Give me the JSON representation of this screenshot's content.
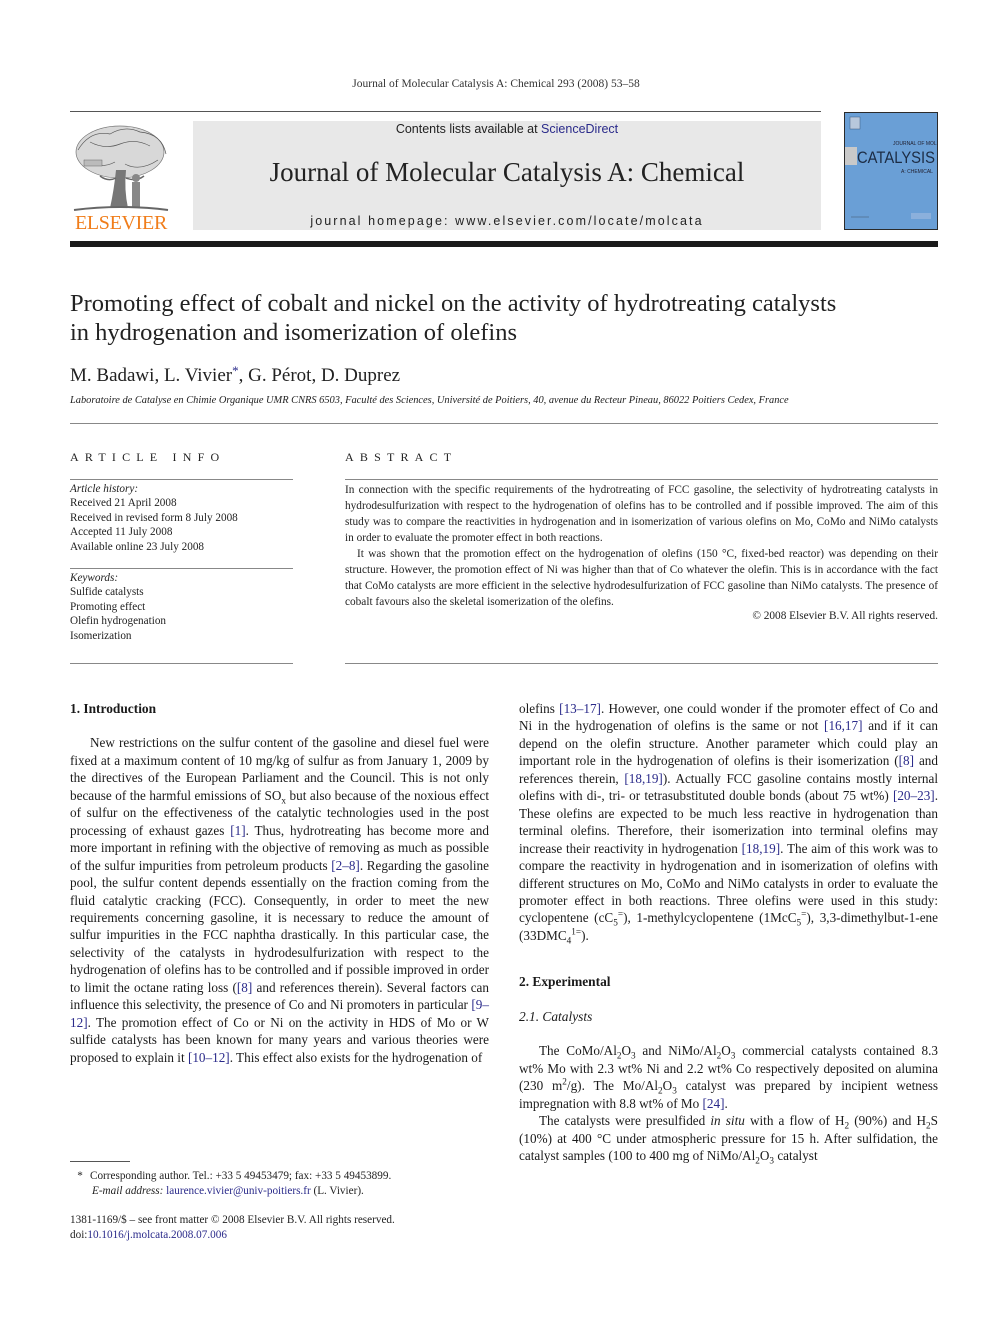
{
  "running_header": "Journal of Molecular Catalysis A: Chemical 293 (2008) 53–58",
  "masthead": {
    "publisher_logo": "ELSEVIER",
    "contents_prefix": "Contents lists available at ",
    "contents_link": "ScienceDirect",
    "journal_title": "Journal of Molecular Catalysis A: Chemical",
    "homepage_label": "journal homepage: ",
    "homepage_url": "www.elsevier.com/locate/molcata",
    "cover": {
      "top_text": "JOURNAL OF MOLECULAR",
      "main_text": "CATALYSIS",
      "sub_text": "A: CHEMICAL",
      "color": "#6a9fd6"
    },
    "logo_color": "#f07d1a"
  },
  "article": {
    "title_line1": "Promoting effect of cobalt and nickel on the activity of hydrotreating catalysts",
    "title_line2": "in hydrogenation and isomerization of olefins",
    "authors": [
      {
        "name": "M. Badawi",
        "sep": ", "
      },
      {
        "name": "L. Vivier",
        "mark": "*",
        "sep": ", "
      },
      {
        "name": "G. Pérot",
        "sep": ", "
      },
      {
        "name": "D. Duprez",
        "sep": ""
      }
    ],
    "affiliation": "Laboratoire de Catalyse en Chimie Organique UMR CNRS 6503, Faculté des Sciences, Université de Poitiers, 40, avenue du Recteur Pineau, 86022 Poitiers Cedex, France"
  },
  "article_info": {
    "heading": "ARTICLE INFO",
    "history_label": "Article history:",
    "history": [
      "Received 21 April 2008",
      "Received in revised form 8 July 2008",
      "Accepted 11 July 2008",
      "Available online 23 July 2008"
    ],
    "keywords_label": "Keywords:",
    "keywords": [
      "Sulfide catalysts",
      "Promoting effect",
      "Olefin hydrogenation",
      "Isomerization"
    ]
  },
  "abstract": {
    "heading": "ABSTRACT",
    "paragraphs": [
      "In connection with the specific requirements of the hydrotreating of FCC gasoline, the selectivity of hydrotreating catalysts in hydrodesulfurization with respect to the hydrogenation of olefins has to be controlled and if possible improved. The aim of this study was to compare the reactivities in hydrogenation and in isomerization of various olefins on Mo, CoMo and NiMo catalysts in order to evaluate the promoter effect in both reactions.",
      "It was shown that the promotion effect on the hydrogenation of olefins (150 °C, fixed-bed reactor) was depending on their structure. However, the promotion effect of Ni was higher than that of Co whatever the olefin. This is in accordance with the fact that CoMo catalysts are more efficient in the selective hydrodesulfurization of FCC gasoline than NiMo catalysts. The presence of cobalt favours also the skeletal isomerization of the olefins."
    ],
    "copyright": "© 2008 Elsevier B.V. All rights reserved."
  },
  "body": {
    "intro_heading": "1.  Introduction",
    "intro_p1": [
      {
        "t": "New restrictions on the sulfur content of the gasoline and diesel fuel were fixed at a maximum content of 10 mg/kg of sulfur as from January 1, 2009 by the directives of the European Parliament and the Council. This is not only because of the harmful emissions of SO"
      },
      {
        "sub": "x"
      },
      {
        "t": " but also because of the noxious effect of sulfur on the effectiveness of the catalytic technologies used in the post processing of exhaust gazes "
      },
      {
        "ref": "[1]"
      },
      {
        "t": ". Thus, hydrotreating has become more and more important in refining with the objective of removing as much as possible of the sulfur impurities from petroleum products "
      },
      {
        "ref": "[2–8]"
      },
      {
        "t": ". Regarding the gasoline pool, the sulfur content depends essentially on the fraction coming from the fluid catalytic cracking (FCC). Consequently, in order to meet the new requirements concerning gasoline, it is necessary to reduce the amount of sulfur impurities in the FCC naphtha drastically. In this particular case, the selectivity of the catalysts in hydrodesulfurization with respect to the hydrogenation of olefins has to be controlled and if possible improved in order to limit the octane rating loss ("
      },
      {
        "ref": "[8]"
      },
      {
        "t": " and references therein). Several factors can influence this selectivity, the presence of Co and Ni promoters in particular "
      },
      {
        "ref": "[9–12]"
      },
      {
        "t": ". The promotion effect of Co or Ni on the activity in HDS of Mo or W sulfide catalysts has been known for many years and various theories were proposed to explain it "
      },
      {
        "ref": "[10–12]"
      },
      {
        "t": ". This effect also exists for the hydrogenation of"
      }
    ],
    "intro_p1_cont": [
      {
        "t": "olefins "
      },
      {
        "ref": "[13–17]"
      },
      {
        "t": ". However, one could wonder if the promoter effect of Co and Ni in the hydrogenation of olefins is the same or not "
      },
      {
        "ref": "[16,17]"
      },
      {
        "t": " and if it can depend on the olefin structure. Another parameter which could play an important role in the hydrogenation of olefins is their isomerization ("
      },
      {
        "ref": "[8]"
      },
      {
        "t": " and references therein, "
      },
      {
        "ref": "[18,19]"
      },
      {
        "t": "). Actually FCC gasoline contains mostly internal olefins with di-, tri- or tetrasubstituted double bonds (about 75 wt%) "
      },
      {
        "ref": "[20–23]"
      },
      {
        "t": ". These olefins are expected to be much less reactive in hydrogenation than terminal olefins. Therefore, their isomerization into terminal olefins may increase their reactivity in hydrogenation "
      },
      {
        "ref": "[18,19]"
      },
      {
        "t": ". The aim of this work was to compare the reactivity in hydrogenation and in isomerization of olefins with different structures on Mo, CoMo and NiMo catalysts in order to evaluate the promoter effect in both reactions. Three olefins were used in this study: cyclopentene (cC"
      },
      {
        "sub": "5"
      },
      {
        "sup": "="
      },
      {
        "t": "), 1-methylcyclopentene (1McC"
      },
      {
        "sub": "5"
      },
      {
        "sup": "="
      },
      {
        "t": "), 3,3-dimethylbut-1-ene (33DMC"
      },
      {
        "sub": "4"
      },
      {
        "sup": "1="
      },
      {
        "t": ")."
      }
    ],
    "exp_heading": "2.  Experimental",
    "catalysts_heading": "2.1.  Catalysts",
    "cat_p1": [
      {
        "t": "The CoMo/Al"
      },
      {
        "sub": "2"
      },
      {
        "t": "O"
      },
      {
        "sub": "3"
      },
      {
        "t": " and NiMo/Al"
      },
      {
        "sub": "2"
      },
      {
        "t": "O"
      },
      {
        "sub": "3"
      },
      {
        "t": " commercial catalysts contained 8.3 wt% Mo with 2.3 wt% Ni and 2.2 wt% Co respectively deposited on alumina (230 m"
      },
      {
        "sup": "2"
      },
      {
        "t": "/g). The Mo/Al"
      },
      {
        "sub": "2"
      },
      {
        "t": "O"
      },
      {
        "sub": "3"
      },
      {
        "t": " catalyst was prepared by incipient wetness impregnation with 8.8 wt% of Mo "
      },
      {
        "ref": "[24]"
      },
      {
        "t": "."
      }
    ],
    "cat_p2": [
      {
        "t": "The catalysts were presulfided "
      },
      {
        "i": "in situ"
      },
      {
        "t": " with a flow of H"
      },
      {
        "sub": "2"
      },
      {
        "t": " (90%) and H"
      },
      {
        "sub": "2"
      },
      {
        "t": "S (10%) at 400 °C under atmospheric pressure for 15 h. After sulfidation, the catalyst samples (100 to 400 mg of NiMo/Al"
      },
      {
        "sub": "2"
      },
      {
        "t": "O"
      },
      {
        "sub": "3"
      },
      {
        "t": " catalyst"
      }
    ]
  },
  "footnote": {
    "mark": "*",
    "corresponding": "Corresponding author. Tel.: +33 5 49453479; fax: +33 5 49453899.",
    "email_label": "E-mail address: ",
    "email": "laurence.vivier@univ-poitiers.fr",
    "email_suffix": " (L. Vivier)."
  },
  "front_matter": {
    "issn_line": "1381-1169/$ – see front matter © 2008 Elsevier B.V. All rights reserved.",
    "doi_label": "doi:",
    "doi": "10.1016/j.molcata.2008.07.006"
  },
  "colors": {
    "link": "#2a2a8a",
    "elsevier_orange": "#f07d1a",
    "band_gray": "#e8e8e8"
  }
}
